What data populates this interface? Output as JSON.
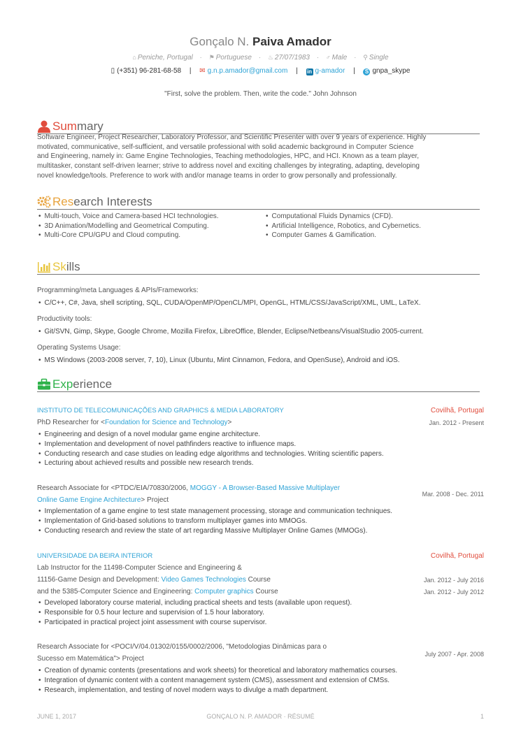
{
  "header": {
    "first_name": "Gonçalo N.",
    "last_name": "Paiva Amador",
    "location": "Peniche, Portugal",
    "nationality": "Portuguese",
    "birthdate": "27/07/1983",
    "gender": "Male",
    "status": "Single",
    "phone": "(+351) 96-281-68-58",
    "email": "g.n.p.amador@gmail.com",
    "linkedin": "g-amador",
    "skype": "gnpa_skype",
    "quote": "\"First, solve the problem. Then, write the code.\" John Johnson"
  },
  "summary": {
    "title_hl": "Sum",
    "title_rest": "mary",
    "lines": [
      "Software Engineer, Project Researcher, Laboratory Professor, and Scientific Presenter with over 9 years of experience. Highly",
      "motivated, communicative, self-sufficient, and versatile professional with solid academic background in Computer Science",
      "and Engineering, namely in: Game Engine Technologies, Teaching methodologies, HPC, and HCI. Known as a team player,",
      "multitasker, constant self-driven learner; strive to address novel and exciting challenges by integrating, adapting, developing",
      "novel knowledge/tools. Preference to work with and/or manage teams in order to grow personally and professionally."
    ]
  },
  "research": {
    "title_hl": "Res",
    "title_rest": "earch Interests",
    "left": [
      "Multi-touch, Voice and Camera-based HCI technologies.",
      "3D Animation/Modelling and Geometrical Computing.",
      "Multi-Core CPU/GPU and Cloud computing."
    ],
    "right": [
      "Computational Fluids Dynamics (CFD).",
      "Artificial Intelligence, Robotics, and Cybernetics.",
      "Computer Games & Gamification."
    ]
  },
  "skills": {
    "title_hl": "Sk",
    "title_rest": "ills",
    "groups": [
      {
        "label": "Programming/meta Languages & APIs/Frameworks:",
        "item": "C/C++, C#, Java, shell scripting, SQL, CUDA/OpenMP/OpenCL/MPI, OpenGL, HTML/CSS/JavaScript/XML, UML, LaTeX."
      },
      {
        "label": "Productivity tools:",
        "item": "Git/SVN, Gimp, Skype, Google Chrome, Mozilla Firefox, LibreOffice, Blender, Eclipse/Netbeans/VisualStudio 2005-current."
      },
      {
        "label": "Operating Systems Usage:",
        "item": "MS Windows (2003-2008 server, 7, 10), Linux (Ubuntu, Mint Cinnamon, Fedora, and OpenSuse), Android and iOS."
      }
    ]
  },
  "experience": {
    "title_hl": "Exp",
    "title_rest": "erience",
    "org1": {
      "name": "INSTITUTO DE TELECOMUNICAÇÕES AND GRAPHICS & MEDIA LABORATORY",
      "location": "Covilhã, Portugal"
    },
    "job1": {
      "role_prefix": "PhD Researcher for <",
      "role_link": "Foundation for Science and Technology",
      "role_suffix": ">",
      "date": "Jan. 2012 - Present",
      "items": [
        "Engineering and design of a novel modular game engine architecture.",
        "Implementation and development of novel pathfinders reactive to influence maps.",
        "Conducting research and case studies on leading edge algorithms and technologies. Writing scientific papers.",
        "Lecturing about achieved results and possible new research trends."
      ]
    },
    "job2": {
      "role_prefix": "Research Associate for <PTDC/EIA/70830/2006, ",
      "role_link1": "MOGGY - A Browser-Based Massive Multiplayer",
      "role_link2": "Online Game Engine Architecture",
      "role_suffix": "> Project",
      "date": "Mar. 2008 - Dec. 2011",
      "items": [
        "Implementation of a game engine to test state management processing, storage and communication techniques.",
        "Implementation of Grid-based solutions to transform multiplayer games into MMOGs.",
        "Conducting research and review the state of art regarding Massive Multiplayer Online Games (MMOGs)."
      ]
    },
    "org2": {
      "name": "UNIVERSIDADE DA BEIRA INTERIOR",
      "location": "Covilhã, Portugal"
    },
    "job3": {
      "line1": "Lab Instructor for the 11498-Computer Science and Engineering &",
      "line2_prefix": "11156-Game Design and Development: ",
      "line2_link": "Video Games Technologies",
      "line2_suffix": " Course",
      "line3_prefix": "and the 5385-Computer Science and Engineering: ",
      "line3_link": "Computer graphics",
      "line3_suffix": " Course",
      "date1": "Jan. 2012 - July 2016",
      "date2": "Jan. 2012 - July 2012",
      "items": [
        "Developed laboratory course material, including practical sheets and tests (available upon request).",
        "Responsible for 0.5 hour lecture and supervision of 1.5 hour laboratory.",
        "Participated in practical project joint assessment with course supervisor."
      ]
    },
    "job4": {
      "line1": "Research Associate for <POCI/V/04.01302/0155/0002/2006, \"Metodologias Dinâmicas para o",
      "line2": "Sucesso em Matemática\"> Project",
      "date": "July 2007 - Apr. 2008",
      "items": [
        "Creation of dynamic contents (presentations and work sheets) for theoretical and laboratory mathematics courses.",
        "Integration of dynamic content with a content management system (CMS), assessment and extension of CMSs.",
        "Research, implementation, and testing of novel modern ways to divulge a math department."
      ]
    }
  },
  "footer": {
    "date": "JUNE 1, 2017",
    "center": "GONÇALO N. P. AMADOR · RÉSUMÉ",
    "page": "1"
  }
}
